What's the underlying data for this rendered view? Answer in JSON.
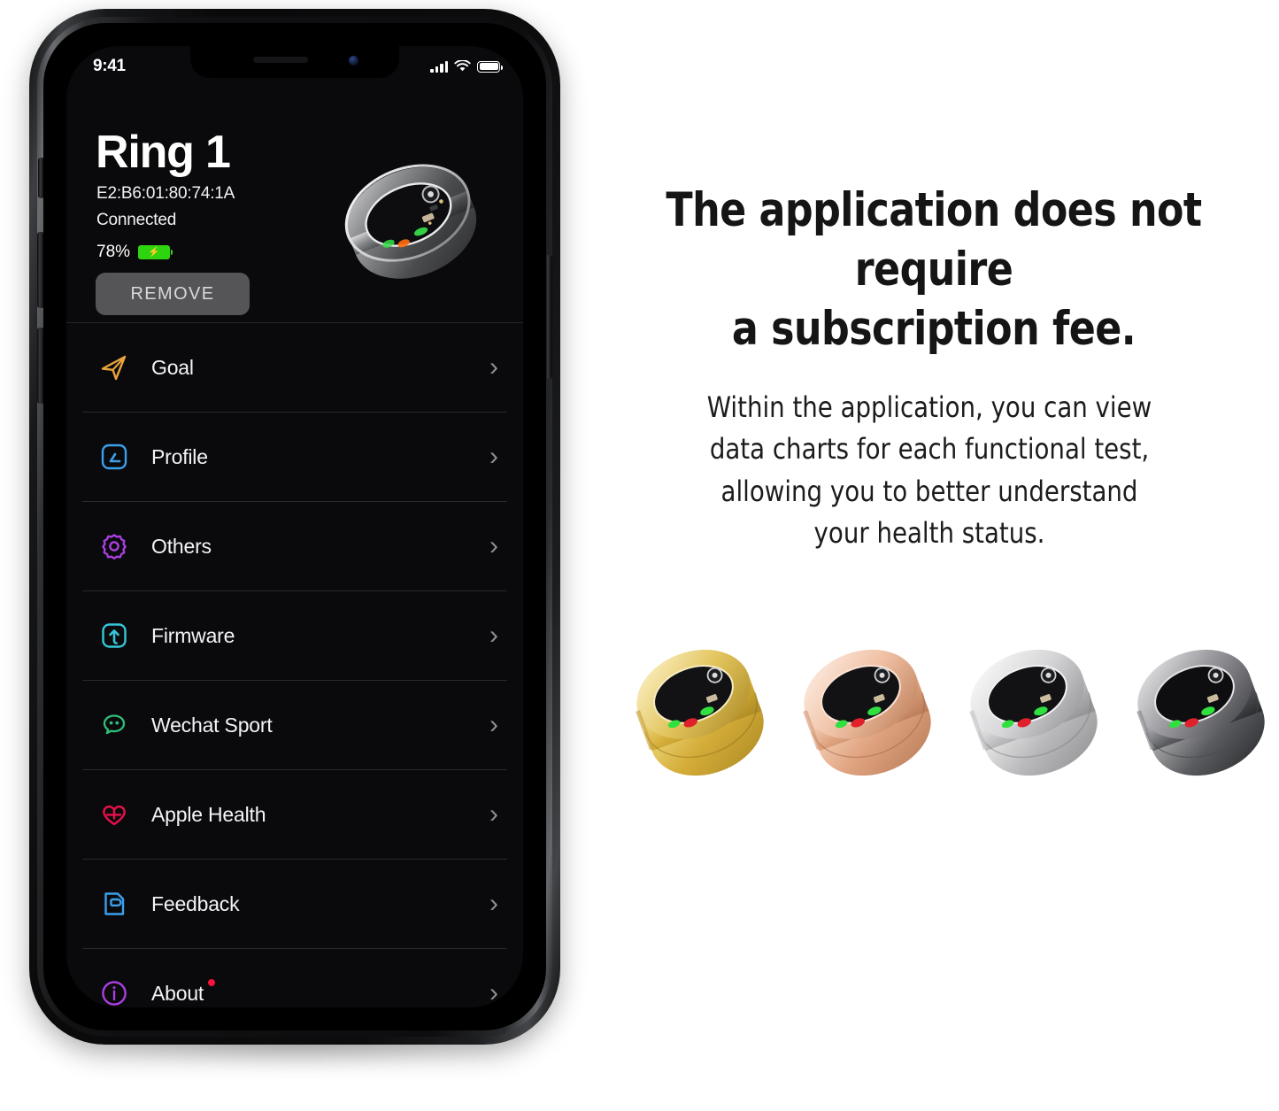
{
  "phone": {
    "status_bar": {
      "time": "9:41",
      "signal_icon": "cellular-bars-icon",
      "wifi_icon": "wifi-icon",
      "battery_icon": "battery-icon"
    },
    "header": {
      "device_name": "Ring 1",
      "mac_address": "E2:B6:01:80:74:1A",
      "connection_status": "Connected",
      "battery_percent": "78%",
      "battery_color": "#2fd411",
      "remove_label": "REMOVE",
      "ring_image_alt": "smart-ring-silver"
    },
    "menu": [
      {
        "label": "Goal",
        "icon": "send-arrow-icon",
        "color": "#e8a33d",
        "badge": false
      },
      {
        "label": "Profile",
        "icon": "profile-card-icon",
        "color": "#3aa0ee",
        "badge": false
      },
      {
        "label": "Others",
        "icon": "gear-icon",
        "color": "#a93fe0",
        "badge": false
      },
      {
        "label": "Firmware",
        "icon": "upload-square-icon",
        "color": "#35c6d8",
        "badge": false
      },
      {
        "label": "Wechat Sport",
        "icon": "wechat-bubble-icon",
        "color": "#2fbf7a",
        "badge": false
      },
      {
        "label": "Apple Health",
        "icon": "heart-plus-icon",
        "color": "#e8104d",
        "badge": false
      },
      {
        "label": "Feedback",
        "icon": "feedback-note-icon",
        "color": "#3aa0ee",
        "badge": false
      },
      {
        "label": "About",
        "icon": "info-circle-icon",
        "color": "#a93fe0",
        "badge": true
      }
    ],
    "chevron_glyph": "›"
  },
  "marketing": {
    "headline_line1": "The application does not require",
    "headline_line2": "a subscription fee.",
    "body_line1": "Within the application, you can view",
    "body_line2": "data charts for each functional test,",
    "body_line3": "allowing you to better understand",
    "body_line4": "your health status.",
    "ring_colors": [
      {
        "name": "gold",
        "body_top": "#f3dc8e",
        "body_mid": "#d9b84a",
        "body_low": "#b9932c",
        "edge": "#fff3c4"
      },
      {
        "name": "rose-gold",
        "body_top": "#f8ddcb",
        "body_mid": "#e8b292",
        "body_low": "#cf9069",
        "edge": "#ffeee4"
      },
      {
        "name": "silver",
        "body_top": "#f4f4f4",
        "body_mid": "#cfcfcf",
        "body_low": "#a8a8a8",
        "edge": "#ffffff"
      },
      {
        "name": "black",
        "body_top": "#dcdcdc",
        "body_mid": "#8e8e90",
        "body_low": "#3c3c3e",
        "edge": "#f0f0f0"
      }
    ]
  }
}
